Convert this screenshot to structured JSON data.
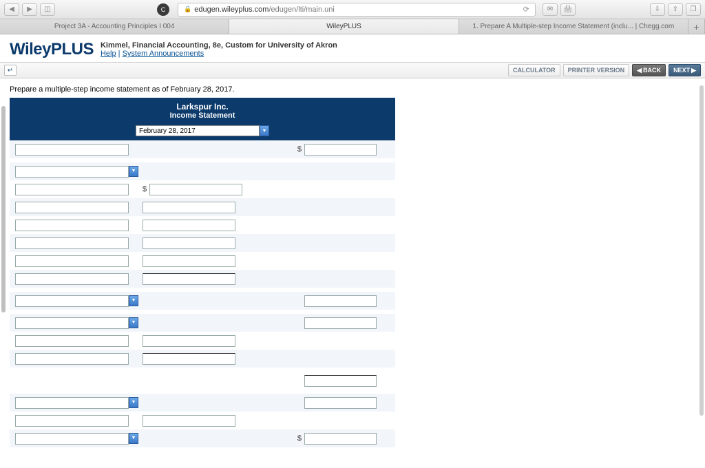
{
  "browser": {
    "url_secure_part": "edugen.wileyplus.com",
    "url_rest": "/edugen/lti/main.uni",
    "tabs": [
      "Project 3A - Accounting Principles I 004",
      "WileyPLUS",
      "1. Prepare A Multiple-step Income Statement (inclu... | Chegg.com"
    ]
  },
  "header": {
    "logo": "WileyPLUS",
    "book": "Kimmel, Financial Accounting, 8e, Custom for University of Akron",
    "help": "Help",
    "sys": "System Announcements"
  },
  "toolbar": {
    "calculator": "CALCULATOR",
    "printer": "PRINTER VERSION",
    "back": "BACK",
    "next": "NEXT"
  },
  "instruction": "Prepare a multiple-step income statement as of February 28, 2017.",
  "statement": {
    "company": "Larkspur Inc.",
    "title": "Income Statement",
    "date": "February 28, 2017",
    "dollar": "$",
    "rows": [
      {
        "type": "alt",
        "c1": "text",
        "c2": "",
        "c3": "dollar_text"
      },
      {
        "type": "spacer"
      },
      {
        "type": "alt",
        "c1": "select",
        "c2": "",
        "c3": ""
      },
      {
        "type": "plain",
        "c1": "text",
        "c2": "dollar_text",
        "c3": ""
      },
      {
        "type": "alt",
        "c1": "text",
        "c2": "text",
        "c3": ""
      },
      {
        "type": "plain",
        "c1": "text",
        "c2": "text",
        "c3": ""
      },
      {
        "type": "alt",
        "c1": "text",
        "c2": "text",
        "c3": ""
      },
      {
        "type": "plain",
        "c1": "text",
        "c2": "text",
        "c3": ""
      },
      {
        "type": "alt",
        "c1": "text",
        "c2": "text_ul",
        "c3": ""
      },
      {
        "type": "spacer"
      },
      {
        "type": "alt",
        "c1": "select",
        "c2": "",
        "c3": "text"
      },
      {
        "type": "spacer"
      },
      {
        "type": "alt",
        "c1": "select",
        "c2": "",
        "c3": "text"
      },
      {
        "type": "plain",
        "c1": "text",
        "c2": "text",
        "c3": ""
      },
      {
        "type": "alt",
        "c1": "text",
        "c2": "text_ul",
        "c3": ""
      },
      {
        "type": "spacer"
      },
      {
        "type": "plain",
        "c1": "",
        "c2": "",
        "c3": "text_ul"
      },
      {
        "type": "spacer"
      },
      {
        "type": "alt",
        "c1": "select",
        "c2": "",
        "c3": "text"
      },
      {
        "type": "plain",
        "c1": "text",
        "c2": "text",
        "c3": ""
      },
      {
        "type": "alt",
        "c1": "select",
        "c2": "",
        "c3": "dollar_text"
      }
    ]
  }
}
